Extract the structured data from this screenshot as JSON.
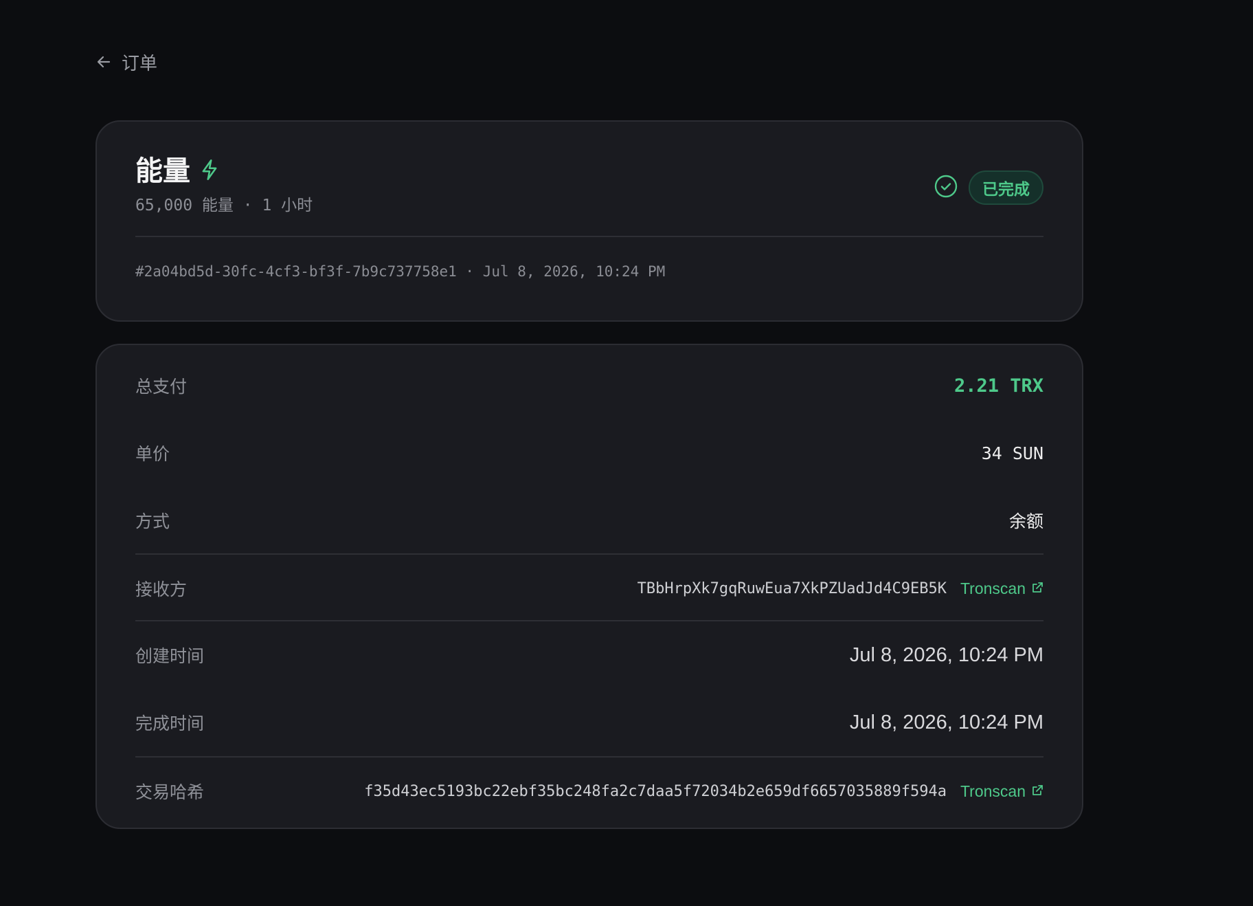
{
  "nav": {
    "back_label": "订单"
  },
  "order": {
    "title": "能量",
    "subtitle": "65,000 能量 · 1 小时",
    "status_label": "已完成",
    "meta": "#2a04bd5d-30fc-4cf3-bf3f-7b9c737758e1 · Jul 8, 2026, 10:24 PM"
  },
  "details": {
    "total": {
      "label": "总支付",
      "value": "2.21 TRX"
    },
    "unit_price": {
      "label": "单价",
      "value": "34 SUN"
    },
    "method": {
      "label": "方式",
      "value": "余额"
    },
    "receiver": {
      "label": "接收方",
      "value": "TBbHrpXk7gqRuwEua7XkPZUadJd4C9EB5K",
      "link_label": "Tronscan"
    },
    "created": {
      "label": "创建时间",
      "value": "Jul 8, 2026, 10:24 PM"
    },
    "completed": {
      "label": "完成时间",
      "value": "Jul 8, 2026, 10:24 PM"
    },
    "tx_hash": {
      "label": "交易哈希",
      "value": "f35d43ec5193bc22ebf35bc248fa2c7daa5f72034b2e659df6657035889f594a",
      "link_label": "Tronscan"
    }
  },
  "icons": {
    "back": "arrow-left-icon",
    "energy": "lightning-bolt-icon",
    "status": "check-circle-icon",
    "external_link": "external-link-icon"
  },
  "colors": {
    "background": "#0c0d10",
    "card": "#1a1b20",
    "accent_green": "#4ec98a",
    "muted_text": "#8f9198"
  }
}
